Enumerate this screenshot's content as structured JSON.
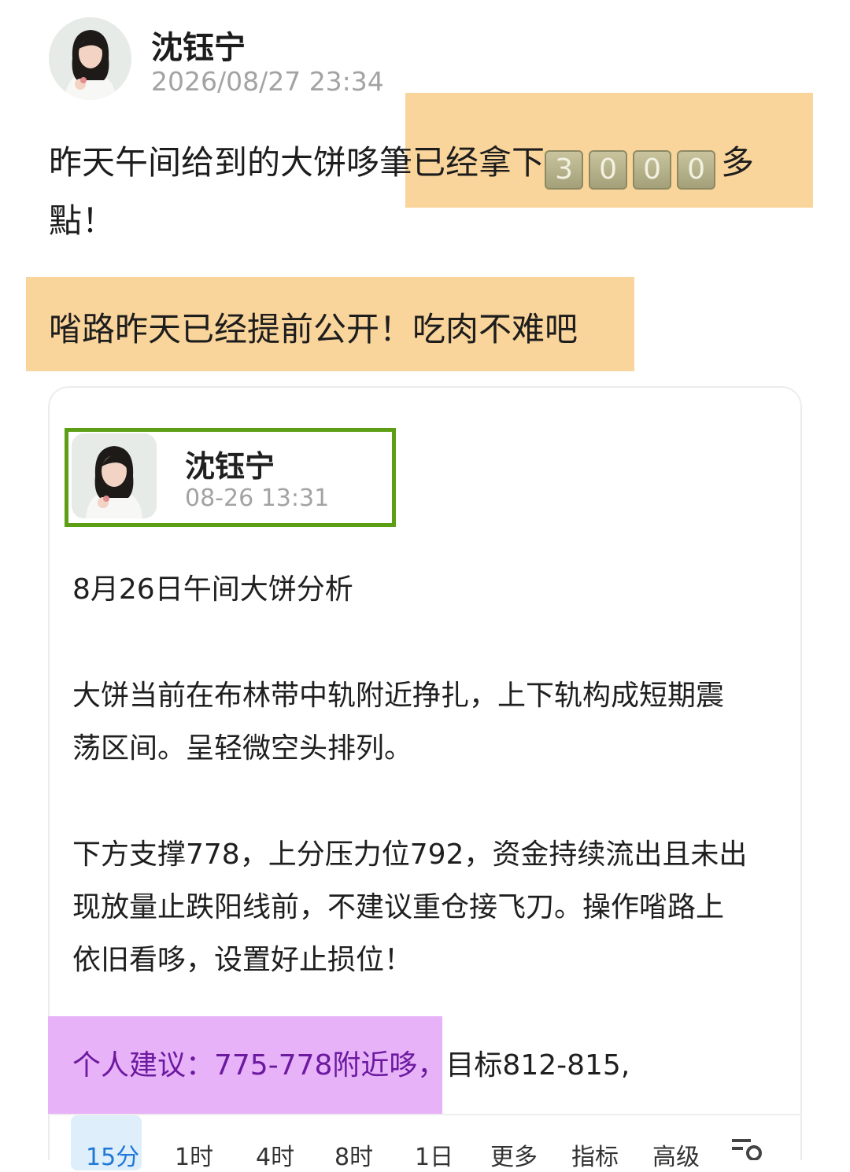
{
  "author": {
    "name": "沈钰宁",
    "time": "2026/08/27 23:34"
  },
  "post": {
    "line1_plain": "昨天午间给到的大饼哆",
    "line1_highlight": "筆已经拿下",
    "digits": [
      "3",
      "0",
      "0",
      "0"
    ],
    "line1_end": "多",
    "line2": "點！",
    "highlight_line": "㗂路昨天已经提前公开！吃肉不难吧"
  },
  "quote": {
    "name": "沈钰宁",
    "time": "08-26 13:31",
    "title": "8月26日午间大饼分析",
    "para1_line1": "大饼当前在布林带中轨附近挣扎，上下轨构成短期震",
    "para1_line2": "荡区间。呈轻微空头排列。",
    "para2_line1": "下方支撑778，上分压力位792，资金持续流出且未出",
    "para2_line2": "现放量止跌阳线前，不建议重仓接飞刀。操作㗂路上",
    "para2_line3": "依旧看哆，设置好止损位！",
    "advice_highlight": "个人建议：775-778附近哆，",
    "advice_rest": "目标812-815,"
  },
  "tabs": [
    "15分",
    "1时",
    "4时",
    "8时",
    "1日",
    "更多",
    "指标",
    "高级"
  ],
  "colors": {
    "orange_highlight": "#f9d49b",
    "purple_highlight": "#e8b2f8",
    "green_border": "#5c9e14",
    "active_tab": "#1e78d8"
  }
}
